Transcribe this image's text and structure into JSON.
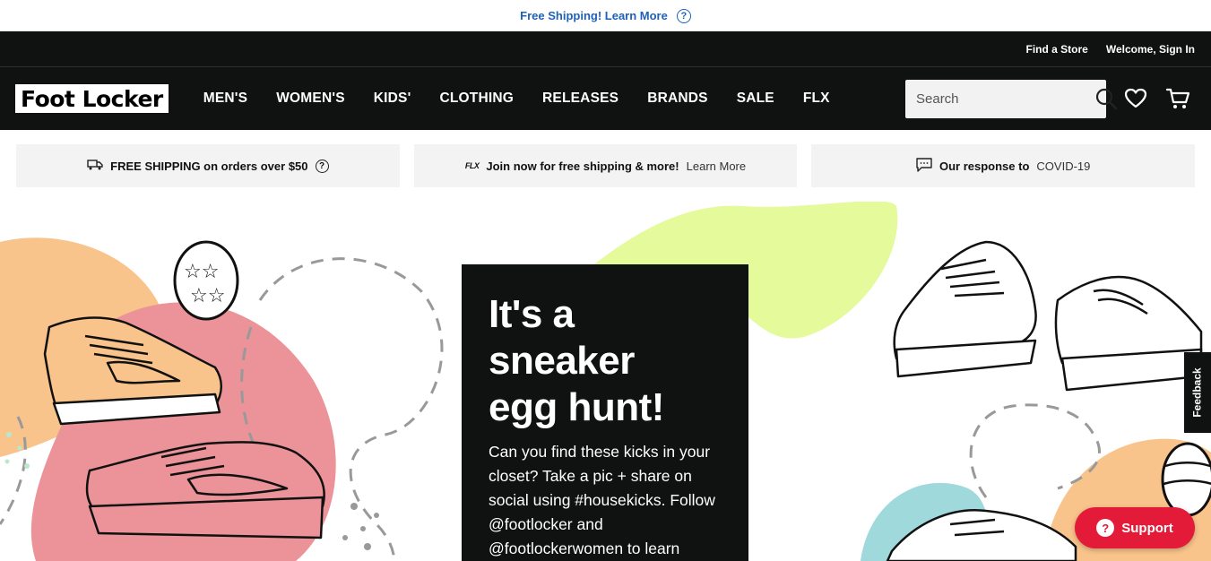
{
  "promo": {
    "text": "Free Shipping! Learn More",
    "help_icon": "question-circle-icon"
  },
  "utility": {
    "find_store": "Find a Store",
    "sign_in": "Welcome, Sign In"
  },
  "brand": {
    "logo_text": "Foot Locker"
  },
  "nav": {
    "items": [
      "MEN'S",
      "WOMEN'S",
      "KIDS'",
      "CLOTHING",
      "RELEASES",
      "BRANDS",
      "SALE",
      "FLX"
    ]
  },
  "search": {
    "placeholder": "Search",
    "icon": "search-icon"
  },
  "header_icons": {
    "wishlist": "heart-icon",
    "cart": "cart-icon"
  },
  "benefits": [
    {
      "icon": "truck-icon",
      "strong": "FREE SHIPPING on orders over $50",
      "link": "",
      "help": "?"
    },
    {
      "icon": "flx-icon",
      "strong": "Join now for free shipping & more!",
      "link": "Learn More"
    },
    {
      "icon": "chat-icon",
      "strong": "Our response to",
      "link": "COVID-19"
    }
  ],
  "hero": {
    "title_line1": "It's a",
    "title_line2": "sneaker",
    "title_line3": "egg hunt!",
    "body": "Can you find these kicks in your closet? Take a pic + share on social using #housekicks. Follow @footlocker and @footlockerwomen to learn"
  },
  "feedback": {
    "label": "Feedback"
  },
  "support": {
    "label": "Support",
    "icon_text": "?"
  },
  "colors": {
    "black": "#101111",
    "link_blue": "#1d61b9",
    "support_red": "#e31b38",
    "blob_orange": "#f9c48b",
    "blob_pink": "#eb9398",
    "blob_lime": "#e4fa9b",
    "blob_teal": "#9fd9dc"
  }
}
